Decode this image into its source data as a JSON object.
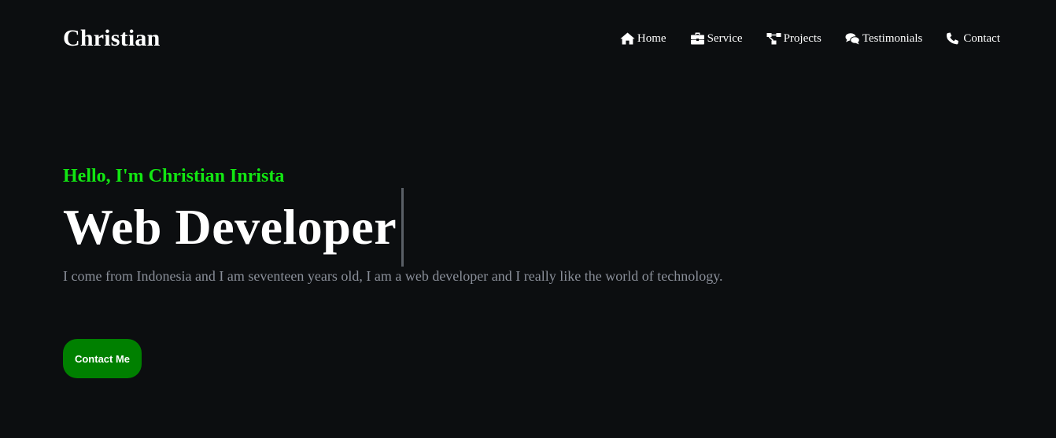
{
  "brand": "Christian",
  "nav": {
    "items": [
      {
        "label": "Home",
        "icon": "home-icon"
      },
      {
        "label": "Service",
        "icon": "briefcase-icon"
      },
      {
        "label": "Projects",
        "icon": "project-diagram-icon"
      },
      {
        "label": "Testimonials",
        "icon": "comments-icon"
      },
      {
        "label": "Contact",
        "icon": "phone-icon"
      }
    ]
  },
  "hero": {
    "greeting": "Hello, I'm Christian Inrista",
    "role": "Web Developer",
    "bio": "I come from Indonesia and I am seventeen years old, I am a web developer and I really like the world of technology.",
    "cta_label": "Contact Me"
  },
  "colors": {
    "background": "#0c0e10",
    "accent": "#12e612",
    "button": "#008000",
    "muted_text": "#8a8f99"
  }
}
